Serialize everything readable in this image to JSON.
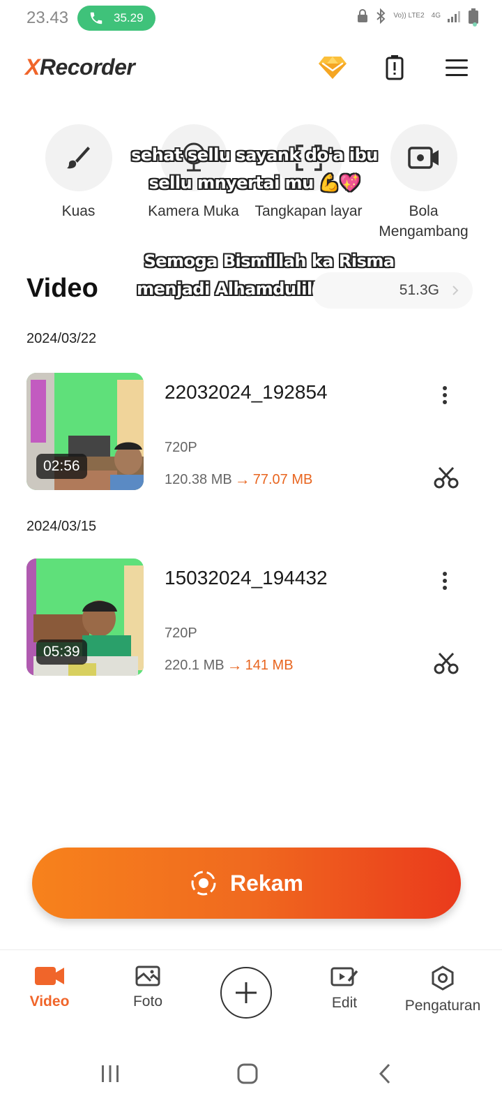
{
  "status_bar": {
    "time": "23.43",
    "call_timer": "35.29",
    "network_volte": "Vo)) LTE2",
    "network_type": "4G"
  },
  "app": {
    "logo_x": "X",
    "logo_rest": "Recorder"
  },
  "tools": [
    {
      "label": "Kuas",
      "icon": "brush-icon"
    },
    {
      "label": "Kamera Muka",
      "icon": "face-camera-icon"
    },
    {
      "label": "Tangkapan layar",
      "icon": "screenshot-icon"
    },
    {
      "label": "Bola Mengambang",
      "icon": "floating-ball-icon"
    }
  ],
  "overlay_captions": {
    "line1": "sehat sellu sayank do'a ibu",
    "line2": "sellu mnyertai mu 💪💖",
    "line3": "Semoga Bismillah ka Risma",
    "line4": "menjadi Alhamdulillah🫶🤲❤️"
  },
  "section": {
    "title": "Video",
    "storage": "51.3G"
  },
  "videos": [
    {
      "date": "2024/03/22",
      "name": "22032024_192854",
      "duration": "02:56",
      "resolution": "720P",
      "original_size": "120.38 MB",
      "compressed_size": "77.07 MB"
    },
    {
      "date": "2024/03/15",
      "name": "15032024_194432",
      "duration": "05:39",
      "resolution": "720P",
      "original_size": "220.1 MB",
      "compressed_size": "141 MB"
    }
  ],
  "record_button": {
    "label": "Rekam"
  },
  "bottom_nav": {
    "video": "Video",
    "foto": "Foto",
    "edit": "Edit",
    "pengaturan": "Pengaturan"
  },
  "colors": {
    "accent": "#f0652a",
    "record_start": "#f7821c",
    "record_end": "#ea3a1c",
    "call_green": "#3fc27a"
  }
}
